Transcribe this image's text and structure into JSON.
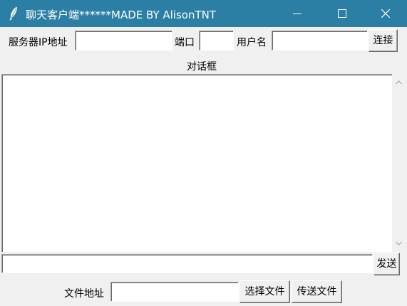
{
  "window": {
    "title": "聊天客户端******MADE BY AlisonTNT",
    "titlebar_color": "#2b7ea4",
    "icons": [
      "feather-icon",
      "minimize-icon",
      "maximize-icon",
      "close-icon"
    ]
  },
  "connection": {
    "server_ip_label": "服务器IP地址",
    "server_ip_value": "",
    "port_label": "端口",
    "port_value": "",
    "username_label": "用户名",
    "username_value": "",
    "connect_button": "连接"
  },
  "chat": {
    "dialog_label": "对话框",
    "message_value": "",
    "send_button": "发送"
  },
  "file": {
    "file_path_label": "文件地址",
    "file_path_value": "",
    "choose_button": "选择文件",
    "transfer_button": "传送文件"
  }
}
